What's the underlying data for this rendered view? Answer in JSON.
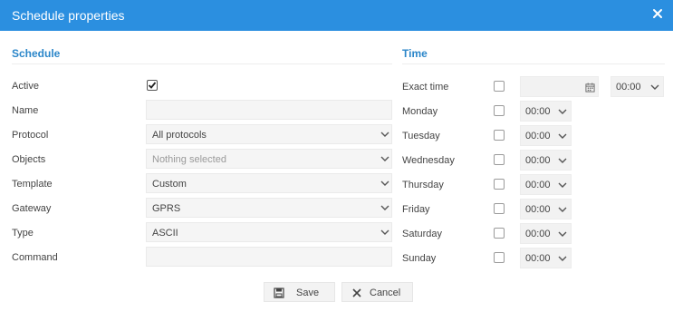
{
  "dialog": {
    "title": "Schedule properties"
  },
  "schedule": {
    "heading": "Schedule",
    "active_label": "Active",
    "active_checked": true,
    "name_label": "Name",
    "name_value": "",
    "protocol_label": "Protocol",
    "protocol_value": "All protocols",
    "objects_label": "Objects",
    "objects_placeholder": "Nothing selected",
    "template_label": "Template",
    "template_value": "Custom",
    "gateway_label": "Gateway",
    "gateway_value": "GPRS",
    "type_label": "Type",
    "type_value": "ASCII",
    "command_label": "Command",
    "command_value": ""
  },
  "time": {
    "heading": "Time",
    "exact_time_label": "Exact time",
    "exact_time_checked": false,
    "exact_date_value": "",
    "exact_time_value": "00:00",
    "days": [
      {
        "label": "Monday",
        "checked": false,
        "time": "00:00"
      },
      {
        "label": "Tuesday",
        "checked": false,
        "time": "00:00"
      },
      {
        "label": "Wednesday",
        "checked": false,
        "time": "00:00"
      },
      {
        "label": "Thursday",
        "checked": false,
        "time": "00:00"
      },
      {
        "label": "Friday",
        "checked": false,
        "time": "00:00"
      },
      {
        "label": "Saturday",
        "checked": false,
        "time": "00:00"
      },
      {
        "label": "Sunday",
        "checked": false,
        "time": "00:00"
      }
    ]
  },
  "buttons": {
    "save": "Save",
    "cancel": "Cancel"
  },
  "icons": {
    "close": "close-icon",
    "calendar": "calendar-icon",
    "save": "floppy-disk-icon",
    "cancel": "x-icon",
    "dropdown": "chevron-down-icon"
  },
  "colors": {
    "title_bar": "#2b8fe0",
    "section_heading": "#2b86c9"
  }
}
